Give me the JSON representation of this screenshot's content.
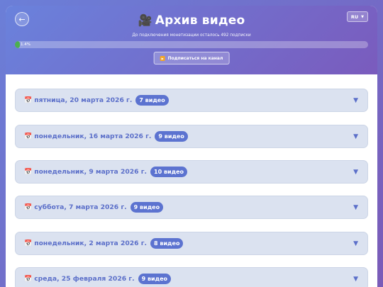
{
  "header": {
    "back_icon": "arrow-left-icon",
    "title_icon": "video-camera-icon",
    "title": "Архив видео",
    "language": "RU",
    "monetization_note": "До подключения монетизации осталось 492 подписки",
    "progress": {
      "value_percent": 1.4,
      "label": "1.4%"
    },
    "subscribe_label": "Подписаться на канал",
    "subscribe_icon": "youtube-icon"
  },
  "days": [
    {
      "date": "пятница, 20 марта 2026 г.",
      "count": "7 видео"
    },
    {
      "date": "понедельник, 16 марта 2026 г.",
      "count": "9 видео"
    },
    {
      "date": "понедельник, 9 марта 2026 г.",
      "count": "10 видео"
    },
    {
      "date": "суббота, 7 марта 2026 г.",
      "count": "9 видео"
    },
    {
      "date": "понедельник, 2 марта 2026 г.",
      "count": "8 видео"
    },
    {
      "date": "среда, 25 февраля 2026 г.",
      "count": "9 видео"
    }
  ],
  "colors": {
    "accent": "#5c73d0",
    "header_gradient_start": "#6a82dc",
    "header_gradient_end": "#7a5bbd",
    "progress_fill": "#4caf50"
  }
}
